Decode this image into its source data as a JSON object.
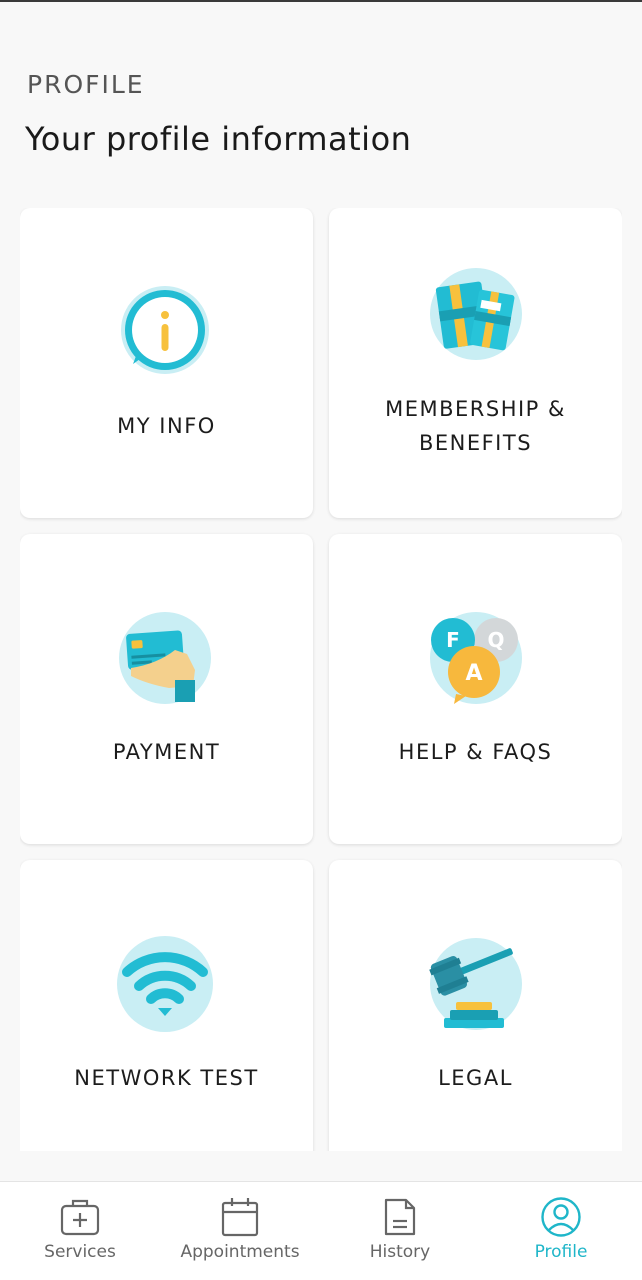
{
  "header": {
    "section_label": "PROFILE",
    "title": "Your profile information"
  },
  "cards": [
    {
      "label": "MY INFO",
      "icon": "info-bubble-icon"
    },
    {
      "label": "MEMBERSHIP & BENEFITS",
      "icon": "membership-cards-icon"
    },
    {
      "label": "PAYMENT",
      "icon": "credit-card-hand-icon"
    },
    {
      "label": "HELP & FAQS",
      "icon": "faq-bubbles-icon"
    },
    {
      "label": "NETWORK TEST",
      "icon": "wifi-icon"
    },
    {
      "label": "LEGAL",
      "icon": "gavel-icon"
    }
  ],
  "nav": [
    {
      "label": "Services",
      "icon": "medical-bag-icon",
      "active": false
    },
    {
      "label": "Appointments",
      "icon": "calendar-icon",
      "active": false
    },
    {
      "label": "History",
      "icon": "document-icon",
      "active": false
    },
    {
      "label": "Profile",
      "icon": "user-circle-icon",
      "active": true
    }
  ],
  "colors": {
    "accent": "#1fb6c9",
    "icon_bg": "#c9eef4",
    "icon_cyan": "#22bcd3",
    "icon_yellow": "#f7c13d"
  }
}
